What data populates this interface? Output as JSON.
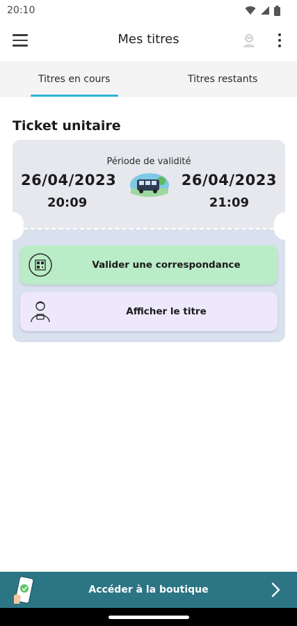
{
  "status": {
    "time": "20:10"
  },
  "app_bar": {
    "title": "Mes titres"
  },
  "tabs": [
    {
      "label": "Titres en cours",
      "active": true
    },
    {
      "label": "Titres restants",
      "active": false
    }
  ],
  "section_title": "Ticket unitaire",
  "ticket": {
    "validity_label": "Période de validité",
    "start_date": "26/04/2023",
    "start_time": "20:09",
    "end_date": "26/04/2023",
    "end_time": "21:09",
    "icon": "bus-icon"
  },
  "actions": {
    "validate_label": "Valider une correspondance",
    "show_label": "Afficher le titre"
  },
  "shop": {
    "label": "Accéder à la boutique"
  },
  "colors": {
    "accent": "#29b4d8",
    "validate_bg": "#b9ecc7",
    "show_bg": "#ede8fb",
    "shop_bg": "#2c7585"
  }
}
